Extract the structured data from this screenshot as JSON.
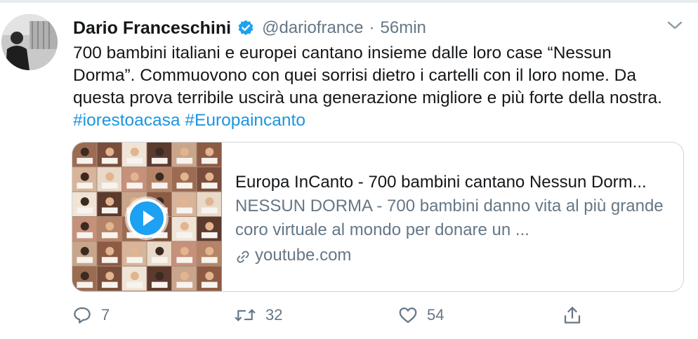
{
  "tweet": {
    "author_name": "Dario Franceschini",
    "handle": "@dariofrance",
    "separator": "·",
    "time": "56min",
    "text": "700 bambini italiani e europei cantano insieme dalle loro case “Nessun Dorma”. Commuovono con quei sorrisi dietro i cartelli con il loro nome. Da questa prova terribile uscirà una generazione migliore e più forte della nostra. ",
    "hashtag_1": "#iorestoacasa",
    "hashtag_2": "#Europaincanto"
  },
  "card": {
    "title": "Europa InCanto - 700 bambini cantano Nessun Dorm...",
    "description": "NESSUN DORMA - 700 bambini danno vita al più grande coro virtuale al mondo per donare un ...",
    "domain": "youtube.com"
  },
  "actions": {
    "replies": "7",
    "retweets": "32",
    "likes": "54"
  },
  "colors": {
    "accent": "#1da1f2",
    "link": "#1b95e0",
    "muted": "#657786",
    "border": "#ccd6dd"
  },
  "icons": [
    "verified-badge-icon",
    "chevron-down-icon",
    "play-icon",
    "link-icon",
    "reply-icon",
    "retweet-icon",
    "like-icon",
    "share-icon"
  ]
}
